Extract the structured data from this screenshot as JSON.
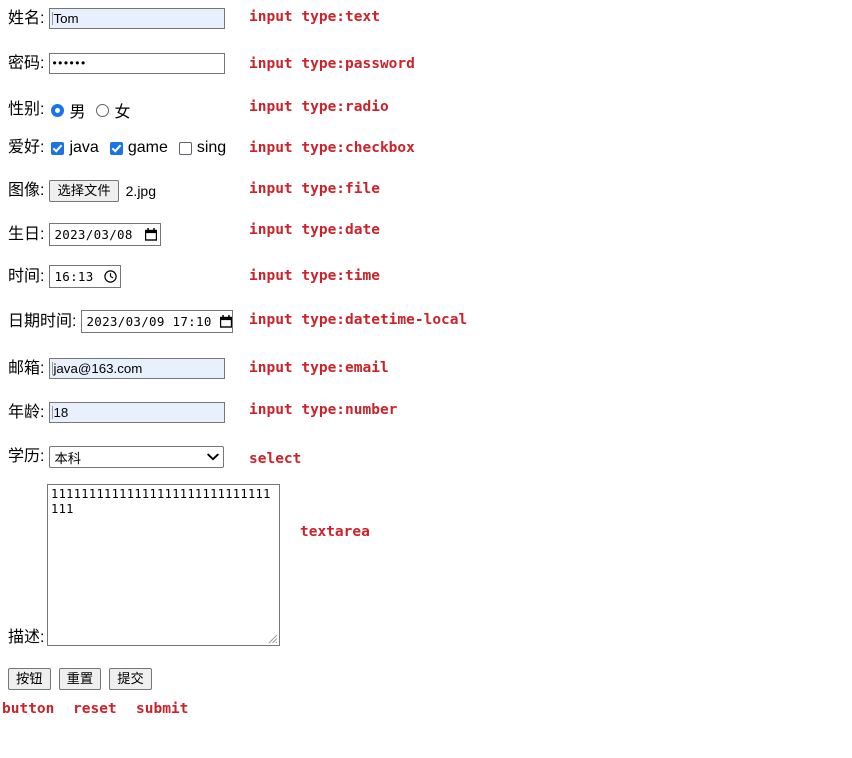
{
  "form": {
    "rows": [
      {
        "label": "姓名:",
        "kind": "text",
        "value": "Tom",
        "annotation": "input type:text"
      },
      {
        "label": "密码:",
        "kind": "password",
        "value": "••••••",
        "annotation": "input type:password"
      },
      {
        "label": "性别:",
        "kind": "radio",
        "annotation": "input type:radio",
        "options": [
          {
            "label": "男",
            "checked": true
          },
          {
            "label": "女",
            "checked": false
          }
        ]
      },
      {
        "label": "爱好:",
        "kind": "checkbox",
        "annotation": "input type:checkbox",
        "options": [
          {
            "label": "java",
            "checked": true
          },
          {
            "label": "game",
            "checked": true
          },
          {
            "label": "sing",
            "checked": false
          }
        ]
      },
      {
        "label": "图像:",
        "kind": "file",
        "button_label": "选择文件",
        "file_name": "2.jpg",
        "annotation": "input type:file"
      },
      {
        "label": "生日:",
        "kind": "date",
        "value": "2023/03/08",
        "picker_icon": "calendar-icon",
        "annotation": "input type:date"
      },
      {
        "label": "时间:",
        "kind": "time",
        "value": "16:13",
        "picker_icon": "clock-icon",
        "annotation": "input type:time"
      },
      {
        "label": "日期时间:",
        "kind": "datetime-local",
        "value": "2023/03/09 17:10",
        "picker_icon": "calendar-icon",
        "annotation": "input type:datetime-local"
      },
      {
        "label": "邮箱:",
        "kind": "email",
        "value": "java@163.com",
        "annotation": "input type:email"
      },
      {
        "label": "年龄:",
        "kind": "number",
        "value": "18",
        "annotation": "input type:number"
      },
      {
        "label": "学历:",
        "kind": "select",
        "value": "本科",
        "arrow_icon": "chevron-down-icon",
        "annotation": "select"
      },
      {
        "label": "描述:",
        "kind": "textarea",
        "value": "11111111111111111111111111111111",
        "annotation": "textarea"
      }
    ],
    "buttons": [
      {
        "label": "按钮",
        "annotation": "button"
      },
      {
        "label": "重置",
        "annotation": "reset"
      },
      {
        "label": "提交",
        "annotation": "submit"
      }
    ]
  },
  "colors": {
    "annotation": "#cc2229",
    "accent": "#1a73e8",
    "autofill": "#e8f0fe",
    "border": "#767676",
    "button_face": "#efefef"
  }
}
